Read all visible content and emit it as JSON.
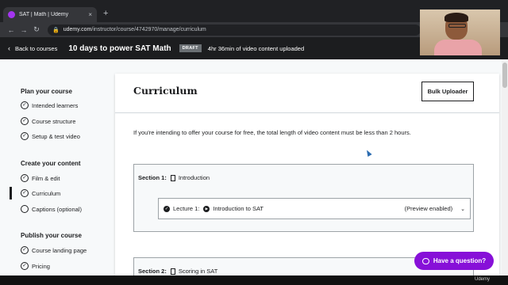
{
  "browser": {
    "tab_title": "SAT | Math | Udemy",
    "tab_close": "×",
    "new_tab": "+",
    "back": "←",
    "forward": "→",
    "reload": "↻",
    "lock": "🔒",
    "url_host": "udemy.com",
    "url_path": "/instructor/course/4742970/manage/curriculum"
  },
  "header": {
    "back_label": "Back to courses",
    "course_title": "10 days to power SAT Math",
    "status_badge": "DRAFT",
    "video_note": "4hr 36min of video content uploaded"
  },
  "sidebar": {
    "groups": [
      {
        "title": "Plan your course",
        "items": [
          "Intended learners",
          "Course structure",
          "Setup & test video"
        ]
      },
      {
        "title": "Create your content",
        "items": [
          "Film & edit",
          "Curriculum",
          "Captions (optional)"
        ]
      },
      {
        "title": "Publish your course",
        "items": [
          "Course landing page",
          "Pricing"
        ]
      }
    ],
    "check_glyph": "✓"
  },
  "main": {
    "title": "Curriculum",
    "bulk_uploader": "Bulk Uploader",
    "notice": "If you're intending to offer your course for free, the total length of video content must be less than 2 hours.",
    "sections": [
      {
        "label": "Section 1:",
        "title": "Introduction",
        "lecture": {
          "label": "Lecture 1:",
          "title": "Introduction to SAT",
          "preview": "(Preview enabled)",
          "chevron": "⌄"
        }
      },
      {
        "label": "Section 2:",
        "title": "Scoring in SAT"
      }
    ]
  },
  "help_button": "Have a question?",
  "watermark": "Udemy",
  "colors": {
    "accent": "#8710d8",
    "header_bg": "#1c1d1f",
    "page_bg": "#f7f9fa"
  }
}
